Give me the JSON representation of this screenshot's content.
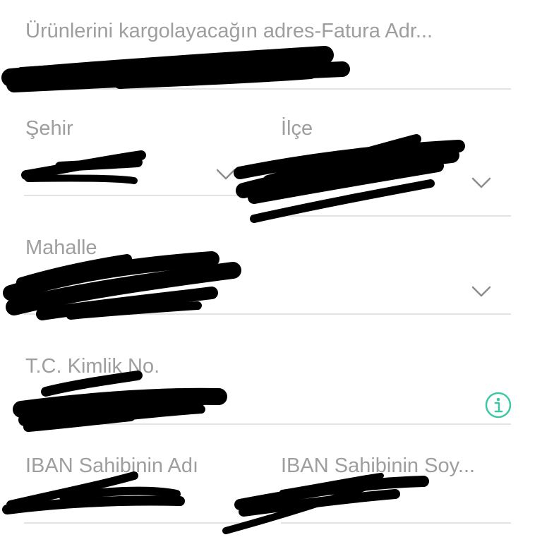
{
  "form": {
    "address_label": "Ürünlerini kargolayacağın adres-Fatura Adr...",
    "city_label": "Şehir",
    "district_label": "İlçe",
    "neighborhood_label": "Mahalle",
    "tc_label": "T.C. Kimlik No.",
    "iban_name_label": "IBAN Sahibinin Adı",
    "iban_surname_label": "IBAN Sahibinin Soy..."
  },
  "icons": {
    "dropdown": "chevron-down-icon",
    "info": "info-icon",
    "accent_color": "#3fc7a4"
  },
  "colors": {
    "label": "#9e9e9e",
    "divider": "#e3e3e3",
    "redaction": "#000000"
  }
}
